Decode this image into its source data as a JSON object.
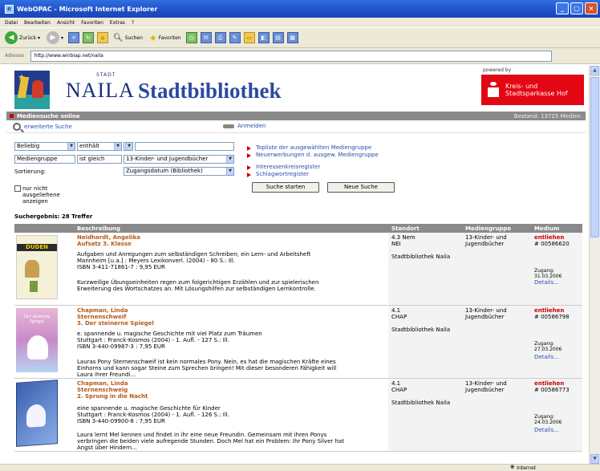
{
  "window": {
    "title": "WebOPAC - Microsoft Internet Explorer"
  },
  "menu": [
    "Datei",
    "Bearbeiten",
    "Ansicht",
    "Favoriten",
    "Extras",
    "?"
  ],
  "toolbar": {
    "back_label": "Zurück",
    "search_label": "Suchen",
    "favorites_label": "Favoriten"
  },
  "address": {
    "label": "Adresse",
    "value": "http://www.winbiap.net/naila"
  },
  "header": {
    "stadt": "STADT",
    "naila": "NAILA",
    "stadtbibliothek": "Stadtbibliothek",
    "powered_by": "powered by",
    "sponsor_line1": "Kreis- und",
    "sponsor_line2": "Stadtsparkasse Hof"
  },
  "bar": {
    "title": "Mediensuche online",
    "bestand": "Bestand: 13725 Medien"
  },
  "nav": {
    "extended_search": "erweiterte Suche",
    "login": "Anmelden"
  },
  "search": {
    "row1_field": "Beliebig",
    "row1_op": "enthält",
    "row2_field": "Mediengruppe",
    "row2_op": "ist gleich",
    "row2_value": "13-Kinder- und Jugendbücher",
    "sort_label": "Sortierung:",
    "sort_value": "Zugangsdatum (Bibliothek)",
    "checkbox_label": "nur nicht ausgeliehene anzeigen",
    "start_button": "Suche starten",
    "new_button": "Neue Suche"
  },
  "links": [
    "Topliste der ausgewählten Mediengruppe",
    "Neuerwerbungen d. ausgew. Mediengruppe",
    "Interessenkreisregister",
    "Schlagwortregister"
  ],
  "result": {
    "count_text": "Suchergebnis: 28 Treffer"
  },
  "table": {
    "headers": [
      "Beschreibung",
      "Standort",
      "Mediengruppe",
      "Medium"
    ],
    "rows": [
      {
        "author": "Neidhardt, Angelika",
        "title1": "Aufsatz 3. Klasse",
        "title2": "",
        "desc1": "Aufgaben und Anregungen zum selbständigen Schreiben; ein Lern- und Arbeitsheft",
        "desc2": "Mannheim [u.a.] : Meyers Lexikonverl. (2004) - 80 S.: Ill.",
        "desc3": "ISBN 3-411-71861-7 : 9,95 EUR",
        "note1": "Kurzweilige Übungseinheiten regen zum folgerichtigen Erzählen und zur spielerischen",
        "note2": "Erweiterung des Wortschatzes an. Mit Lösungshilfen zur selbständigen Lernkontrolle.",
        "note3": "",
        "stand1": "4.3 Nem",
        "stand2": "NEI",
        "stand3": "Stadtbibliothek Naila",
        "group1": "13-Kinder- und",
        "group2": "Jugendbücher",
        "status": "entliehen",
        "number": "# 00586620",
        "zugang": "Zugang: 31.03.2006",
        "details": "Details...",
        "cover_text": "DUDEN"
      },
      {
        "author": "Chapman, Linda",
        "title1": "Sternenschweif",
        "title2": "3. Der steinerne Spiegel",
        "desc1": "e. spannende u. magische Geschichte mit viel Platz zum Träumen",
        "desc2": "Stuttgart : Franck-Kosmos (2004) - 1. Aufl. - 127 S.: Ill.",
        "desc3": "ISBN 3-440-09987-3 : 7,95 EUR",
        "note1": "Lauras Pony Sternenschweif ist kein normales Pony. Nein, es hat die magischen Kräfte eines",
        "note2": "Einhorns und kann sogar Steine zum Sprechen bringen! Mit dieser besonderen Fähigkeit will",
        "note3": "Laura ihrer Freundi...",
        "stand1": "4.1",
        "stand2": "CHAP",
        "stand3": "Stadtbibliothek Naila",
        "group1": "13-Kinder- und",
        "group2": "Jugendbücher",
        "status": "entliehen",
        "number": "# 00586798",
        "zugang": "Zugang: 27.03.2006",
        "details": "Details...",
        "cover_text": "Der steinerne Spiegel"
      },
      {
        "author": "Chapman, Linda",
        "title1": "Sternenschweig",
        "title2": "2. Sprung in die Nacht",
        "desc1": "eine spannende u. magische Geschichte für Kinder",
        "desc2": "Stuttgart : Franck-Kosmos (2004) - 1. Aufl. - 126 S.: Ill.",
        "desc3": "ISBN 3-440-09900-8 : 7,95 EUR",
        "note1": "Laura lernt Mel kennen und findet in ihr eine neue Freundin. Gemeinsam mit ihren Ponys",
        "note2": "verbringen die beiden viele aufregende Stunden. Doch Mel hat ein Problem: Ihr Pony Silver hat",
        "note3": "Angst über Hindern...",
        "stand1": "4.1",
        "stand2": "CHAP",
        "stand3": "Stadtbibliothek Naila",
        "group1": "13-Kinder- und",
        "group2": "Jugendbücher",
        "status": "entliehen",
        "number": "# 00586773",
        "zugang": "Zugang: 24.03.2006",
        "details": "Details...",
        "cover_text": ""
      }
    ]
  },
  "status": {
    "zone": "Internet"
  }
}
